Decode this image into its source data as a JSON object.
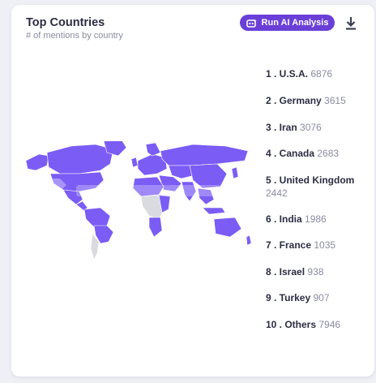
{
  "card": {
    "title": "Top Countries",
    "subtitle": "# of mentions by country",
    "ai_button_label": "Run AI Analysis",
    "download_icon": "download-icon",
    "ai_icon": "ai-sparkle-icon"
  },
  "colors": {
    "accent": "#6a3fd8",
    "map_highlight": "#7b5cf5",
    "map_base": "#d9dbe1",
    "title": "#2b2d42",
    "muted": "#8a8ca0"
  },
  "countries": [
    {
      "label": "1 . U.S.A.",
      "count": "6876"
    },
    {
      "label": "2 . Germany",
      "count": "3615"
    },
    {
      "label": "3 . Iran",
      "count": "3076"
    },
    {
      "label": "4 . Canada",
      "count": "2683"
    },
    {
      "label": "5 . United Kingdom",
      "count": "2442"
    },
    {
      "label": "6 . India",
      "count": "1986"
    },
    {
      "label": "7 . France",
      "count": "1035"
    },
    {
      "label": "8 . Israel",
      "count": "938"
    },
    {
      "label": "9 . Turkey",
      "count": "907"
    },
    {
      "label": "10 . Others",
      "count": "7946"
    }
  ]
}
